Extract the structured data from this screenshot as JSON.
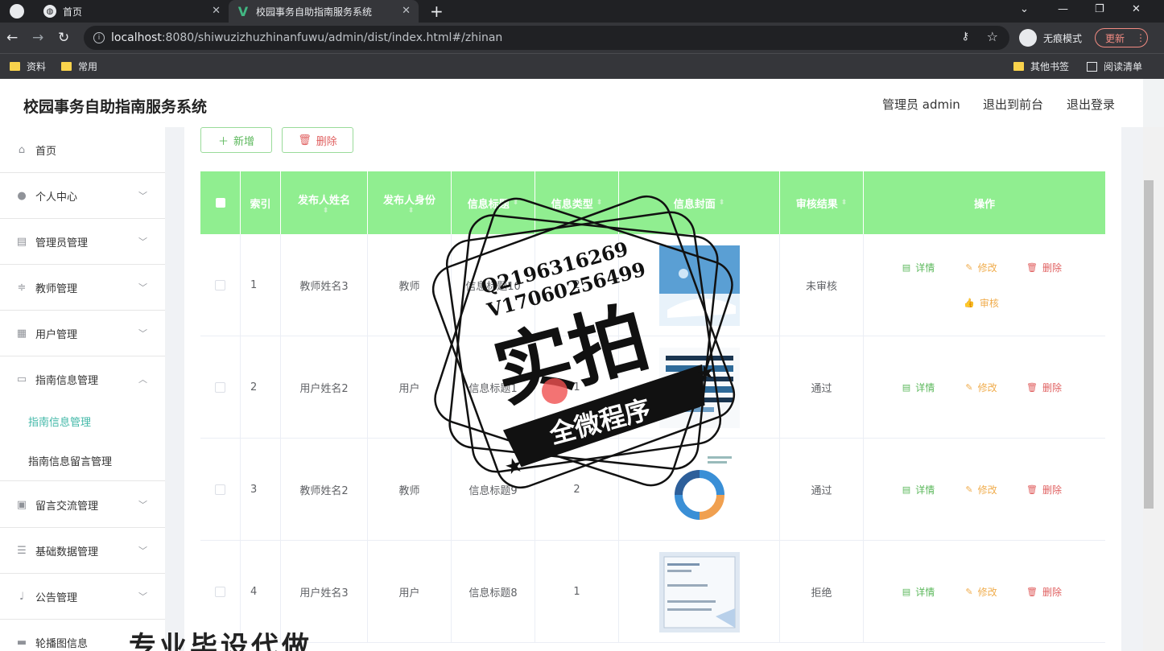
{
  "browser": {
    "tabs": [
      {
        "label": "首页",
        "active": false
      },
      {
        "label": "校园事务自助指南服务系统",
        "active": true
      }
    ],
    "url_host": "localhost",
    "url_rest": ":8080/shiwuzizhuzhinanfuwu/admin/dist/index.html#/zhinan",
    "incognito_label": "无痕模式",
    "update_label": "更新",
    "bookmarks": [
      "资料",
      "常用"
    ],
    "bookmarks_right": [
      "其他书签",
      "阅读清单"
    ]
  },
  "header": {
    "title": "校园事务自助指南服务系统",
    "admin_label": "管理员 admin",
    "exit_front": "退出到前台",
    "logout": "退出登录"
  },
  "sidebar": {
    "items": [
      {
        "label": "首页",
        "icon": "home-icon"
      },
      {
        "label": "个人中心",
        "icon": "user-icon"
      },
      {
        "label": "管理员管理",
        "icon": "id-card-icon"
      },
      {
        "label": "教师管理",
        "icon": "sliders-icon"
      },
      {
        "label": "用户管理",
        "icon": "grid-icon"
      },
      {
        "label": "指南信息管理",
        "icon": "chat-icon"
      },
      {
        "label": "留言交流管理",
        "icon": "clipboard-icon"
      },
      {
        "label": "基础数据管理",
        "icon": "list-icon"
      },
      {
        "label": "公告管理",
        "icon": "mic-icon"
      },
      {
        "label": "轮播图信息",
        "icon": "image-icon"
      }
    ],
    "subitems": [
      {
        "label": "指南信息管理",
        "active": true
      },
      {
        "label": "指南信息留言管理",
        "active": false
      }
    ]
  },
  "toolbar": {
    "add_label": "新增",
    "delete_label": "删除"
  },
  "table": {
    "columns": [
      "索引",
      "发布人姓名",
      "发布人身份",
      "信息标题",
      "信息类型",
      "信息封面",
      "审核结果",
      "操作"
    ],
    "rows": [
      {
        "index": "1",
        "name": "教师姓名3",
        "role": "教师",
        "title": "信息标题10",
        "type": "2",
        "result": "未审核",
        "audit": true
      },
      {
        "index": "2",
        "name": "用户姓名2",
        "role": "用户",
        "title": "信息标题1",
        "type": "1",
        "result": "通过",
        "audit": false
      },
      {
        "index": "3",
        "name": "教师姓名2",
        "role": "教师",
        "title": "信息标题9",
        "type": "2",
        "result": "通过",
        "audit": false
      },
      {
        "index": "4",
        "name": "用户姓名3",
        "role": "用户",
        "title": "信息标题8",
        "type": "1",
        "result": "拒绝",
        "audit": false
      }
    ],
    "ops": {
      "detail": "详情",
      "edit": "修改",
      "delete": "删除",
      "audit": "审核"
    }
  },
  "watermark": {
    "qq": "Q2196316269",
    "vx": "V17060256499",
    "big": "实拍",
    "ribbon": "全微程序",
    "bottom": "专业毕设代做"
  },
  "colors": {
    "table_header": "#90ee90",
    "accent": "#42b8a8",
    "detail": "#5cb85c",
    "edit": "#f0ad4e",
    "delete": "#e06060"
  }
}
